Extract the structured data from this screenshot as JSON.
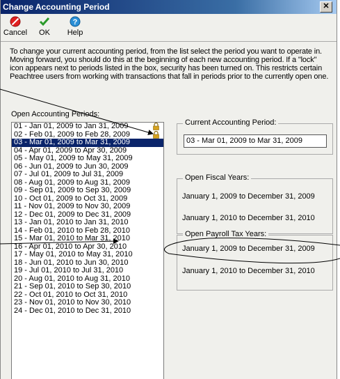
{
  "window": {
    "title": "Change Accounting Period",
    "close_glyph": "✕"
  },
  "toolbar": {
    "cancel_label": "Cancel",
    "ok_label": "OK",
    "help_label": "Help",
    "cancel_icon": "cancel-icon",
    "ok_icon": "checkmark-icon",
    "help_icon": "help-icon"
  },
  "intro_text": "To change your current accounting period, from the list select the period you want to operate in. Moving forward, you should do this at the beginning of each new accounting period.  If a \"lock\" icon appears next to periods listed in the box, security has been turned on.  This restricts certain Peachtree users from working with transactions that fall in periods prior to the currently open one.",
  "periods_label": "Open Accounting Periods:",
  "periods": [
    {
      "label": "01 - Jan  01, 2009 to Jan  31, 2009",
      "locked": true,
      "selected": false
    },
    {
      "label": "02 - Feb  01, 2009 to Feb  28, 2009",
      "locked": true,
      "selected": false
    },
    {
      "label": "03 - Mar  01, 2009 to Mar  31, 2009",
      "locked": false,
      "selected": true
    },
    {
      "label": "04 - Apr  01, 2009 to Apr  30, 2009",
      "locked": false,
      "selected": false
    },
    {
      "label": "05 - May  01, 2009 to May  31, 2009",
      "locked": false,
      "selected": false
    },
    {
      "label": "06 - Jun  01, 2009 to Jun  30, 2009",
      "locked": false,
      "selected": false
    },
    {
      "label": "07 - Jul  01, 2009 to Jul  31, 2009",
      "locked": false,
      "selected": false
    },
    {
      "label": "08 - Aug  01, 2009 to Aug  31, 2009",
      "locked": false,
      "selected": false
    },
    {
      "label": "09 - Sep  01, 2009 to Sep  30, 2009",
      "locked": false,
      "selected": false
    },
    {
      "label": "10 - Oct  01, 2009 to Oct  31, 2009",
      "locked": false,
      "selected": false
    },
    {
      "label": "11 - Nov  01, 2009 to Nov  30, 2009",
      "locked": false,
      "selected": false
    },
    {
      "label": "12 - Dec  01, 2009 to Dec  31, 2009",
      "locked": false,
      "selected": false
    },
    {
      "label": "13 - Jan  01, 2010 to Jan  31, 2010",
      "locked": false,
      "selected": false
    },
    {
      "label": "14 - Feb  01, 2010 to Feb  28, 2010",
      "locked": false,
      "selected": false
    },
    {
      "label": "15 - Mar  01, 2010 to Mar  31, 2010",
      "locked": false,
      "selected": false
    },
    {
      "label": "16 - Apr  01, 2010 to Apr  30, 2010",
      "locked": false,
      "selected": false
    },
    {
      "label": "17 - May  01, 2010 to May  31, 2010",
      "locked": false,
      "selected": false
    },
    {
      "label": "18 - Jun  01, 2010 to Jun  30, 2010",
      "locked": false,
      "selected": false
    },
    {
      "label": "19 - Jul  01, 2010 to Jul  31, 2010",
      "locked": false,
      "selected": false
    },
    {
      "label": "20 - Aug  01, 2010 to Aug  31, 2010",
      "locked": false,
      "selected": false
    },
    {
      "label": "21 - Sep  01, 2010 to Sep  30, 2010",
      "locked": false,
      "selected": false
    },
    {
      "label": "22 - Oct  01, 2010 to Oct  31, 2010",
      "locked": false,
      "selected": false
    },
    {
      "label": "23 - Nov  01, 2010 to Nov  30, 2010",
      "locked": false,
      "selected": false
    },
    {
      "label": "24 - Dec  01, 2010 to Dec  31, 2010",
      "locked": false,
      "selected": false
    }
  ],
  "current_period": {
    "title": "Current Accounting Period:",
    "value": "03 - Mar 01, 2009 to Mar 31, 2009"
  },
  "fiscal_years": {
    "title": "Open Fiscal Years:",
    "items": [
      "January 1, 2009 to December 31, 2009",
      "January 1, 2010 to December 31, 2010"
    ]
  },
  "payroll_years": {
    "title": "Open Payroll Tax Years:",
    "items": [
      "January 1, 2009 to December 31, 2009",
      "January 1, 2010 to December 31, 2010"
    ]
  },
  "colors": {
    "selection": "#0a246a",
    "titlebar": "#0a246a",
    "lock": "#d6a21e"
  }
}
